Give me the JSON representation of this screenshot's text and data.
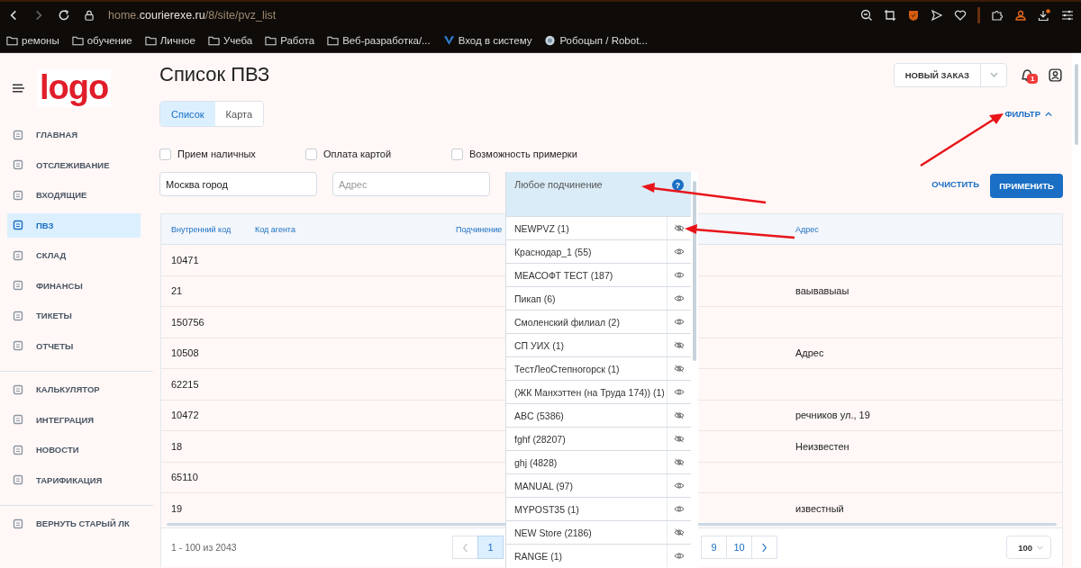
{
  "browser": {
    "address": {
      "subdomain": "home.",
      "domain": "courierexe.ru",
      "path": "/8/site/pvz_list"
    },
    "bookmarks": [
      {
        "kind": "folder",
        "label": "ремоны"
      },
      {
        "kind": "folder",
        "label": "обучение"
      },
      {
        "kind": "folder",
        "label": "Личное"
      },
      {
        "kind": "folder",
        "label": "Учеба"
      },
      {
        "kind": "folder",
        "label": "Работа"
      },
      {
        "kind": "folder",
        "label": "Веб-разработка/..."
      },
      {
        "kind": "site",
        "label": "Вход в систему"
      },
      {
        "kind": "avatar",
        "label": "Робоцып / Robot..."
      }
    ]
  },
  "sidebar": {
    "logo": "logo",
    "groups": [
      {
        "items": [
          {
            "label": "ГЛАВНАЯ",
            "selected": false
          },
          {
            "label": "ОТСЛЕЖИВАНИЕ",
            "selected": false
          },
          {
            "label": "ВХОДЯЩИЕ",
            "selected": false
          },
          {
            "label": "ПВЗ",
            "selected": true
          },
          {
            "label": "СКЛАД",
            "selected": false
          },
          {
            "label": "ФИНАНСЫ",
            "selected": false
          },
          {
            "label": "ТИКЕТЫ",
            "selected": false
          },
          {
            "label": "ОТЧЕТЫ",
            "selected": false
          }
        ]
      },
      {
        "items": [
          {
            "label": "КАЛЬКУЛЯТОР",
            "selected": false
          },
          {
            "label": "ИНТЕГРАЦИЯ",
            "selected": false
          },
          {
            "label": "НОВОСТИ",
            "selected": false
          },
          {
            "label": "ТАРИФИКАЦИЯ",
            "selected": false
          }
        ]
      },
      {
        "items": [
          {
            "label": "ВЕРНУТЬ СТАРЫЙ ЛК",
            "selected": false
          }
        ]
      }
    ]
  },
  "header": {
    "title": "Список ПВЗ",
    "new_order": "НОВЫЙ ЗАКАЗ",
    "notifications": "1"
  },
  "view_tabs": [
    {
      "label": "Список",
      "selected": true
    },
    {
      "label": "Карта",
      "selected": false
    }
  ],
  "filter_toggle": {
    "label": "ФИЛЬТР",
    "expanded": true
  },
  "filters": {
    "checkboxes": [
      {
        "label": "Прием наличных",
        "checked": false
      },
      {
        "label": "Оплата картой",
        "checked": false
      },
      {
        "label": "Возможность примерки",
        "checked": false
      }
    ],
    "city": {
      "value": "Москва город"
    },
    "address": {
      "placeholder": "Адрес"
    },
    "subordination": {
      "value": "Любое подчинение",
      "help": "?",
      "options": [
        {
          "label": "NEWPVZ (1)",
          "hidden": true
        },
        {
          "label": "Краснодар_1 (55)",
          "hidden": false
        },
        {
          "label": "МЕАСОФТ ТЕСТ (187)",
          "hidden": false
        },
        {
          "label": "Пикап (6)",
          "hidden": false
        },
        {
          "label": "Смоленский филиал (2)",
          "hidden": false
        },
        {
          "label": "СП УИХ (1)",
          "hidden": true
        },
        {
          "label": "ТестЛеоСтепногорск (1)",
          "hidden": true
        },
        {
          "label": "(ЖК Манхэттен (на Труда 174)) (1)",
          "hidden": false
        },
        {
          "label": "ABC (5386)",
          "hidden": true
        },
        {
          "label": "fghf (28207)",
          "hidden": true
        },
        {
          "label": "ghj (4828)",
          "hidden": true
        },
        {
          "label": "MANUAL (97)",
          "hidden": false
        },
        {
          "label": "MYPOST35 (1)",
          "hidden": false
        },
        {
          "label": "NEW Store (2186)",
          "hidden": true
        },
        {
          "label": "RANGE (1)",
          "hidden": false
        }
      ]
    },
    "clear": "ОЧИСТИТЬ",
    "apply": "ПРИМЕНИТЬ"
  },
  "table": {
    "columns": [
      "Внутренний код",
      "Код агента",
      "Подчинение",
      "Адрес"
    ],
    "rows": [
      {
        "internal_code": "10471"
      },
      {
        "internal_code": "21",
        "address": "ваывавыаы"
      },
      {
        "internal_code": "150756"
      },
      {
        "internal_code": "10508",
        "address": "Адрес"
      },
      {
        "internal_code": "62215"
      },
      {
        "internal_code": "10472",
        "address": "речников ул., 19"
      },
      {
        "internal_code": "18",
        "address": "Неизвестен"
      },
      {
        "internal_code": "65110"
      },
      {
        "internal_code": "19",
        "address": "известный"
      }
    ]
  },
  "footer": {
    "range": "1 - 100  из  2043",
    "pages": [
      {
        "label": "1",
        "selected": true
      },
      {
        "label": "9",
        "selected": false
      },
      {
        "label": "10",
        "selected": false
      }
    ],
    "per_page": "100"
  }
}
